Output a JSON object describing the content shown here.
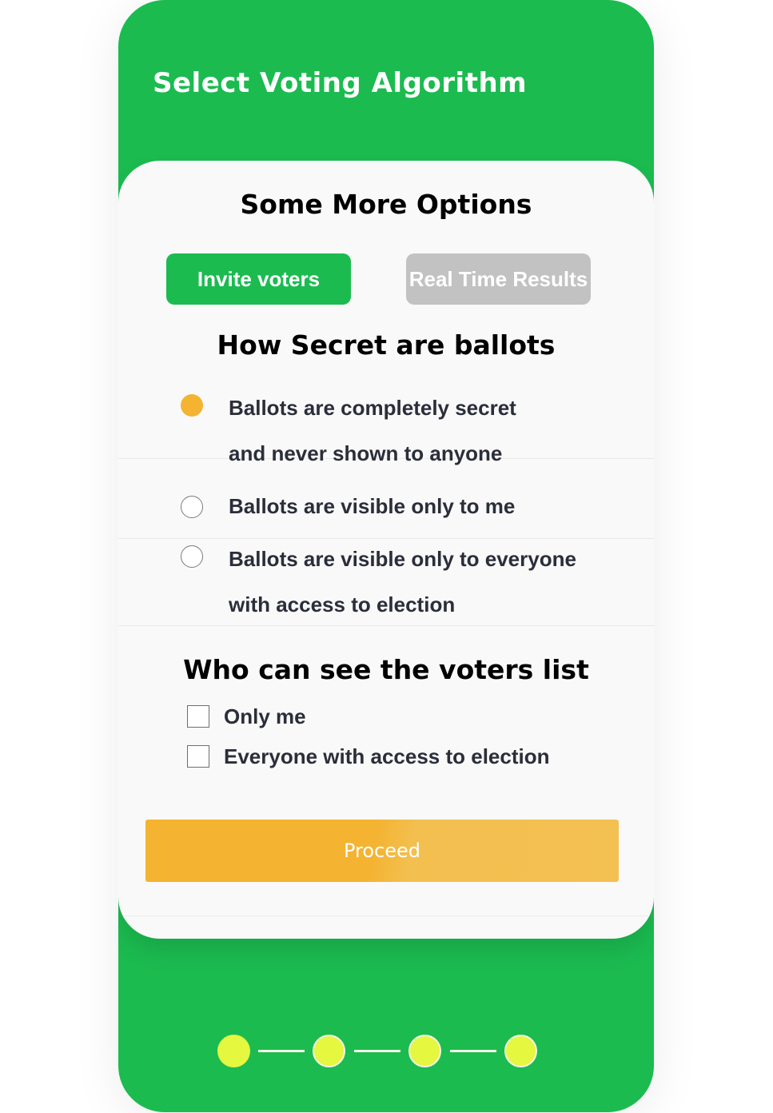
{
  "header": {
    "title": "Select Voting Algorithm"
  },
  "options_section": {
    "title": "Some More Options",
    "tabs": [
      {
        "label": "Invite voters",
        "active": true
      },
      {
        "label": "Real Time Results",
        "active": false
      }
    ]
  },
  "ballot_secrecy": {
    "title": "How Secret are ballots",
    "selected_index": 0,
    "options": [
      {
        "label_lines": [
          "Ballots are completely secret",
          "and never shown to anyone"
        ],
        "selected": true
      },
      {
        "label_lines": [
          "Ballots are visible only to me"
        ],
        "selected": false
      },
      {
        "label_lines": [
          "Ballots are visible only to everyone",
          "with access to election"
        ],
        "selected": false
      }
    ]
  },
  "voters_list": {
    "title": "Who can see the voters list",
    "options": [
      {
        "label": "Only me",
        "checked": false
      },
      {
        "label": "Everyone with access to election",
        "checked": false
      }
    ]
  },
  "proceed_button": {
    "label": "Proceed"
  },
  "stepper": {
    "total_steps": 4,
    "current_step": 1
  },
  "colors": {
    "primary_green": "#1bbb50",
    "accent_orange": "#f4b331",
    "inactive_gray": "#c2c2c2",
    "step_yellow": "#e5f73f",
    "card_background": "#f9f9f9",
    "text_dark": "#2b2e3a"
  },
  "icons": {
    "radio_selected": "radio-selected-icon",
    "radio_unselected": "radio-unselected-icon",
    "checkbox_unchecked": "checkbox-unchecked-icon",
    "step_dot": "step-dot-icon"
  }
}
